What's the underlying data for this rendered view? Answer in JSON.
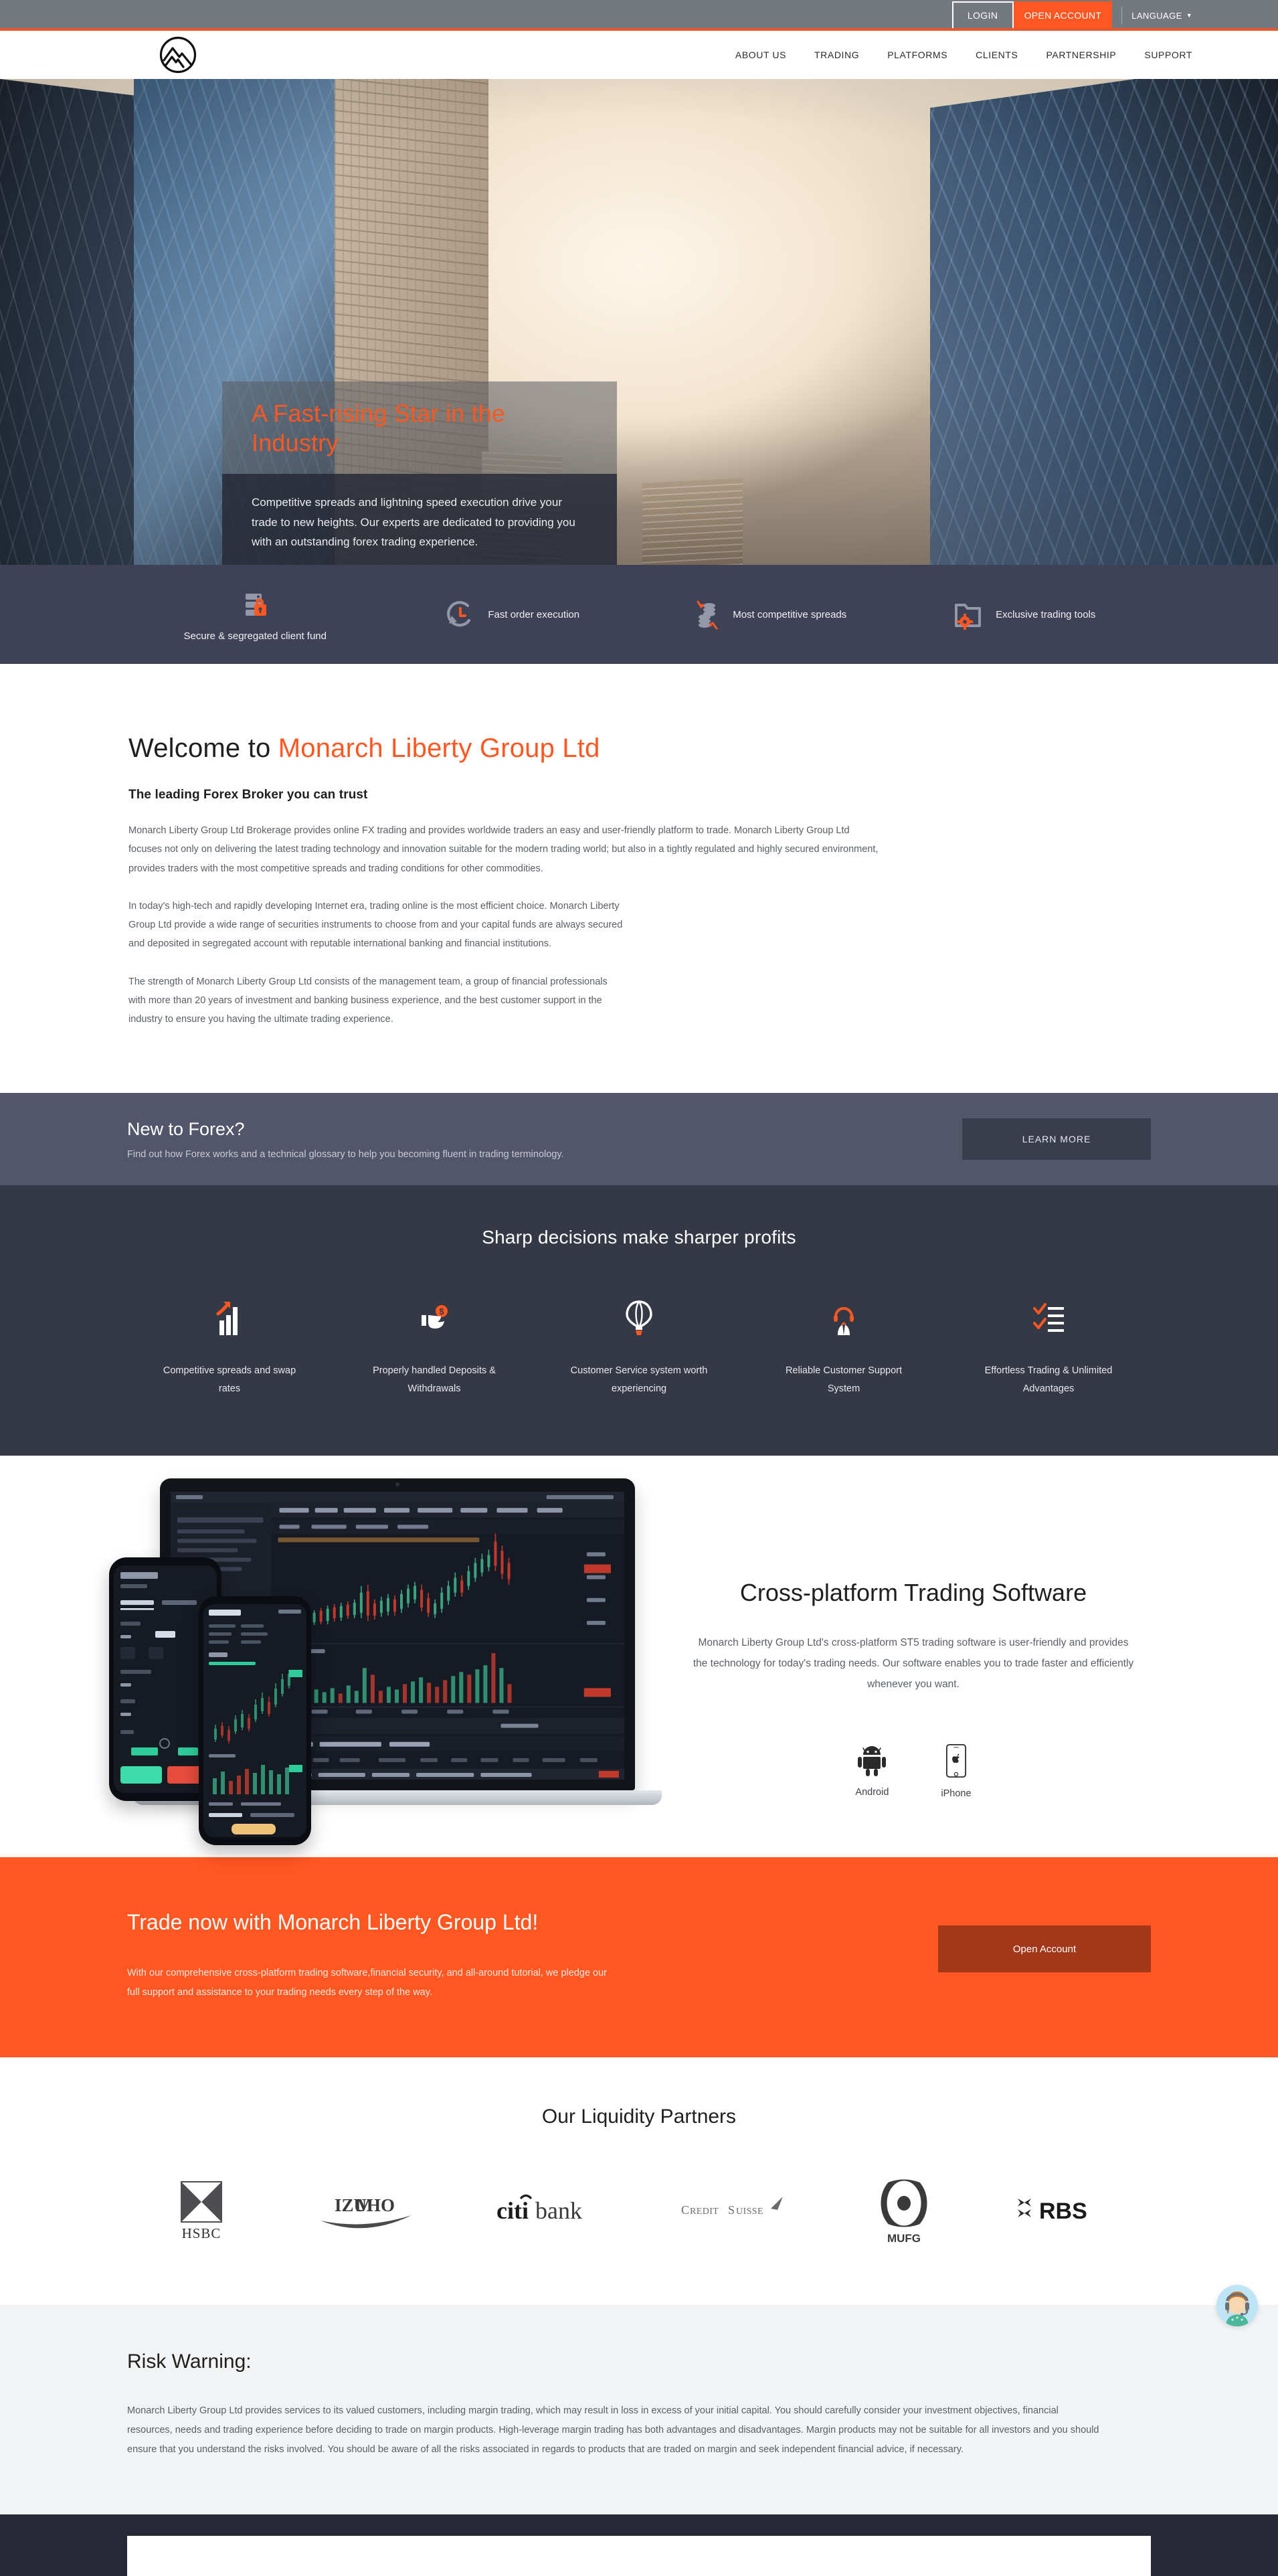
{
  "topbar": {
    "login_label": "LOGIN",
    "open_account_label": "OPEN ACCOUNT",
    "language_label": "LANGUAGE",
    "language_caret": "▼"
  },
  "nav": {
    "logo_name": "mountain-circle-logo",
    "items": [
      {
        "label": "ABOUT US"
      },
      {
        "label": "TRADING"
      },
      {
        "label": "PLATFORMS"
      },
      {
        "label": "CLIENTS"
      },
      {
        "label": "PARTNERSHIP"
      },
      {
        "label": "SUPPORT"
      }
    ]
  },
  "hero": {
    "title": "A Fast-rising Star in the Industry",
    "body": "Competitive spreads and lightning speed execution drive your trade to new heights. Our experts are dedicated to providing you with an outstanding forex trading experience."
  },
  "feature_strip": [
    {
      "icon": "server-lock-icon",
      "label": "Secure & segregated client fund"
    },
    {
      "icon": "clock-arrow-icon",
      "label": "Fast order execution"
    },
    {
      "icon": "coins-arrows-icon",
      "label": "Most competitive spreads"
    },
    {
      "icon": "folder-gear-icon",
      "label": "Exclusive trading tools"
    }
  ],
  "welcome": {
    "heading_prefix": "Welcome to ",
    "heading_accent": "Monarch Liberty Group Ltd",
    "subheading": "The leading Forex Broker you can trust",
    "paragraph1": "Monarch Liberty Group Ltd Brokerage provides online FX trading and provides worldwide traders an easy and user-friendly platform to trade. Monarch Liberty Group Ltd focuses not only on delivering the latest trading technology and innovation suitable for the modern trading world; but also in a tightly regulated and highly secured environment, provides traders with the most competitive spreads and trading conditions for other commodities.",
    "paragraph2": "In today's high-tech and rapidly developing Internet era, trading online is the most efficient choice. Monarch Liberty Group Ltd provide a wide range of securities instruments to choose from and your capital funds are always secured and deposited in segregated account with reputable international banking and financial institutions.",
    "paragraph3": "The strength of Monarch Liberty Group Ltd consists of the management team, a group of financial professionals with more than 20 years of investment and banking business experience, and the best customer support in the industry to ensure you having the ultimate trading experience."
  },
  "forex_band": {
    "heading": "New to Forex?",
    "subheading": "Find out how Forex works and a technical glossary to help you becoming fluent in trading terminology.",
    "button_label": "LEARN MORE"
  },
  "sharp": {
    "heading": "Sharp decisions make sharper profits",
    "items": [
      {
        "icon": "bar-chart-arrow-icon",
        "label": "Competitive spreads and swap rates"
      },
      {
        "icon": "hand-coin-icon",
        "label": "Properly handled Deposits & Withdrawals"
      },
      {
        "icon": "hot-air-balloon-icon",
        "label": "Customer Service system worth experiencing"
      },
      {
        "icon": "support-agent-icon",
        "label": "Reliable Customer Support System"
      },
      {
        "icon": "checklist-icon",
        "label": "Effortless Trading & Unlimited Advantages"
      }
    ]
  },
  "cross_platform": {
    "heading": "Cross-platform Trading Software",
    "paragraph": "Monarch Liberty Group Ltd's cross-platform ST5 trading software is user-friendly and provides the technology for today's trading needs. Our software enables you to trade faster and efficiently whenever you want.",
    "platforms": [
      {
        "icon": "android-icon",
        "label": "Android"
      },
      {
        "icon": "iphone-icon",
        "label": "iPhone"
      }
    ]
  },
  "cta": {
    "heading": "Trade now with Monarch Liberty Group Ltd!",
    "paragraph": "With our comprehensive cross-platform trading software,financial security, and all-around tutorial, we pledge our full support and assistance to your trading needs every step of the way.",
    "button_label": "Open Account"
  },
  "partners": {
    "heading": "Our Liquidity Partners",
    "logos": [
      {
        "name": "hsbc-logo",
        "label": "HSBC"
      },
      {
        "name": "mizuho-logo",
        "label": "MIZUHO"
      },
      {
        "name": "citibank-logo",
        "label": "citibank"
      },
      {
        "name": "credit-suisse-logo",
        "label": "CREDIT SUISSE"
      },
      {
        "name": "mufg-logo",
        "label": "MUFG"
      },
      {
        "name": "rbs-logo",
        "label": "RBS"
      }
    ]
  },
  "risk": {
    "heading": "Risk Warning:",
    "paragraph": "Monarch Liberty Group Ltd provides services to its valued customers, including margin trading, which may result in loss in excess of your initial capital. You should carefully consider your investment objectives, financial resources, needs and trading experience before deciding to trade on margin products. High-leverage margin trading has both advantages and disadvantages. Margin products may not be suitable for all investors and you should ensure that you understand the risks involved. You should be aware of all the risks associated in regards to products that are traded on margin and seek independent financial advice, if necessary."
  },
  "chat": {
    "icon": "support-agent-avatar-icon"
  },
  "colors": {
    "accent_orange": "#FF5722",
    "topbar_grey": "#74787f",
    "strip_navy": "#3f4157",
    "band_grey": "#53566a",
    "sharp_dark": "#353845",
    "cta_button": "#A3371A",
    "risk_bg": "#f1f3f5",
    "footer_dark": "#272a36"
  }
}
